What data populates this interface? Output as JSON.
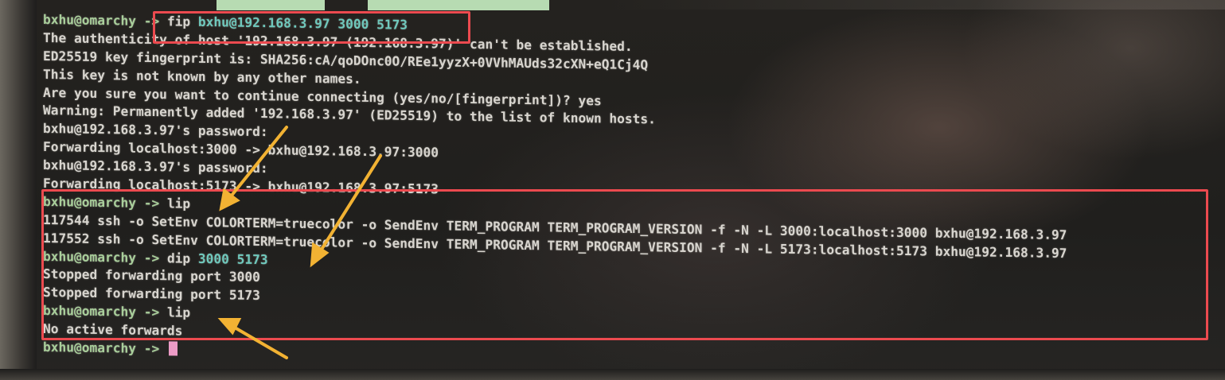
{
  "terminal": {
    "lines": [
      {
        "prompt": "bxhu@omarchy",
        "arrow": " -> ",
        "cmd": "fip ",
        "args": "bxhu@192.168.3.97 3000 5173"
      },
      {
        "text": "The authenticity of host '192.168.3.97 (192.168.3.97)' can't be established."
      },
      {
        "text": "ED25519 key fingerprint is: SHA256:cA/qoDOnc0O/REe1yyzX+0VVhMAUds32cXN+eQ1Cj4Q"
      },
      {
        "text": "This key is not known by any other names."
      },
      {
        "text": "Are you sure you want to continue connecting (yes/no/[fingerprint])? yes"
      },
      {
        "text": "Warning: Permanently added '192.168.3.97' (ED25519) to the list of known hosts."
      },
      {
        "text": "bxhu@192.168.3.97's password:"
      },
      {
        "text": "Forwarding localhost:3000 -> bxhu@192.168.3.97:3000"
      },
      {
        "text": "bxhu@192.168.3.97's password:"
      },
      {
        "text": "Forwarding localhost:5173 -> bxhu@192.168.3.97:5173"
      },
      {
        "prompt": "bxhu@omarchy",
        "arrow": " -> ",
        "cmd": "lip",
        "args": ""
      },
      {
        "text": "117544 ssh -o SetEnv COLORTERM=truecolor -o SendEnv TERM_PROGRAM TERM_PROGRAM_VERSION -f -N -L 3000:localhost:3000 bxhu@192.168.3.97"
      },
      {
        "text": "117552 ssh -o SetEnv COLORTERM=truecolor -o SendEnv TERM_PROGRAM TERM_PROGRAM_VERSION -f -N -L 5173:localhost:5173 bxhu@192.168.3.97"
      },
      {
        "prompt": "bxhu@omarchy",
        "arrow": " -> ",
        "cmd": "dip ",
        "args": "3000 5173"
      },
      {
        "text": "Stopped forwarding port 3000"
      },
      {
        "text": "Stopped forwarding port 5173"
      },
      {
        "prompt": "bxhu@omarchy",
        "arrow": " -> ",
        "cmd": "lip",
        "args": ""
      },
      {
        "text": "No active forwards"
      },
      {
        "prompt": "bxhu@omarchy",
        "arrow": " -> ",
        "cmd": "",
        "args": ""
      }
    ]
  },
  "colors": {
    "prompt": "#a9cf9b",
    "args": "#6fc9bd",
    "output": "#d8d5cf",
    "cursor": "#ec9bc6",
    "highlight_box": "#ec4a4f",
    "annotation_arrow": "#f2b233"
  },
  "annotations": {
    "highlight_boxes": [
      "fip command",
      "lip / dip command output"
    ],
    "arrows": [
      "arrow-to-lip",
      "arrow-to-dip-args",
      "arrow-to-second-lip"
    ]
  }
}
